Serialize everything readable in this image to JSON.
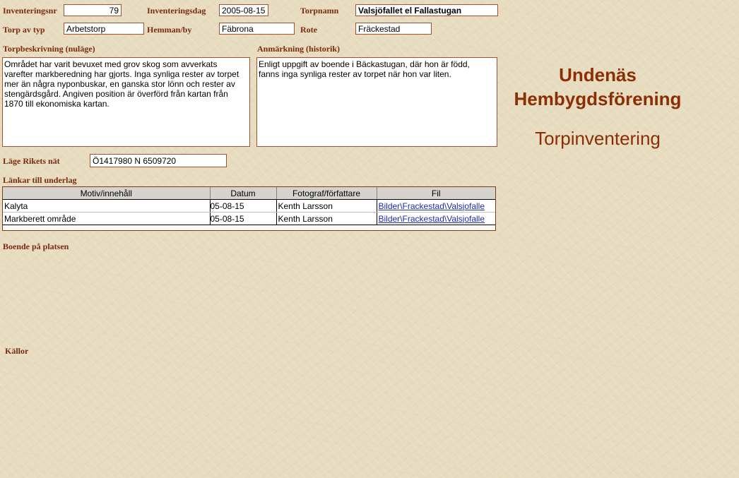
{
  "fields": {
    "inventeringsnr_label": "Inventeringsnr",
    "inventeringsnr": "79",
    "inventeringsdag_label": "Inventeringsdag",
    "inventeringsdag": "2005-08-15",
    "torpnamn_label": "Torpnamn",
    "torpnamn": "Valsjöfallet el Fallastugan",
    "torp_av_typ_label": "Torp av typ",
    "torp_av_typ": "Arbetstorp",
    "hemman_by_label": "Hemman/by",
    "hemman_by": "Fäbrona",
    "rote_label": "Rote",
    "rote": "Fräckestad",
    "torpbeskrivning_label": "Torpbeskrivning (nuläge)",
    "torpbeskrivning": "Området har varit bevuxet med grov skog som avverkats\nvarefter markberedning har gjorts. Inga synliga rester av torpet\nmer än några nyponbuskar, en ganska stor lönn och rester av\nstengärdsgård. Angiven position är överförd från kartan från\n1870 till ekonomiska kartan.",
    "anmarkning_label": "Anmärkning (historik)",
    "anmarkning": "Enligt uppgift av boende i Bäckastugan, där hon är född,\nfanns inga synliga rester av torpet när hon var liten.",
    "lage_label": "Läge Rikets nät",
    "lage": "Ö1417980  N 6509720",
    "lankar_label": "Länkar till underlag",
    "boende_label": "Boende på platsen",
    "kallor_label": "Källor"
  },
  "header": {
    "org_line1": "Undenäs",
    "org_line2": "Hembygdsförening",
    "subtitle": "Torpinventering"
  },
  "links_table": {
    "columns": [
      "Motiv/innehåll",
      "Datum",
      "Fotograf/författare",
      "Fil"
    ],
    "rows": [
      [
        "Kalyta",
        "05-08-15",
        "Kenth Larsson",
        "Bilder\\Frackestad\\Valsjofalle"
      ],
      [
        "Markberett område",
        "05-08-15",
        "Kenth Larsson",
        "Bilder\\Frackestad\\Valsjofalle"
      ]
    ]
  },
  "colors": {
    "label": "#7b2a0d",
    "title": "#8b2e04",
    "link": "#1f2aa8"
  }
}
